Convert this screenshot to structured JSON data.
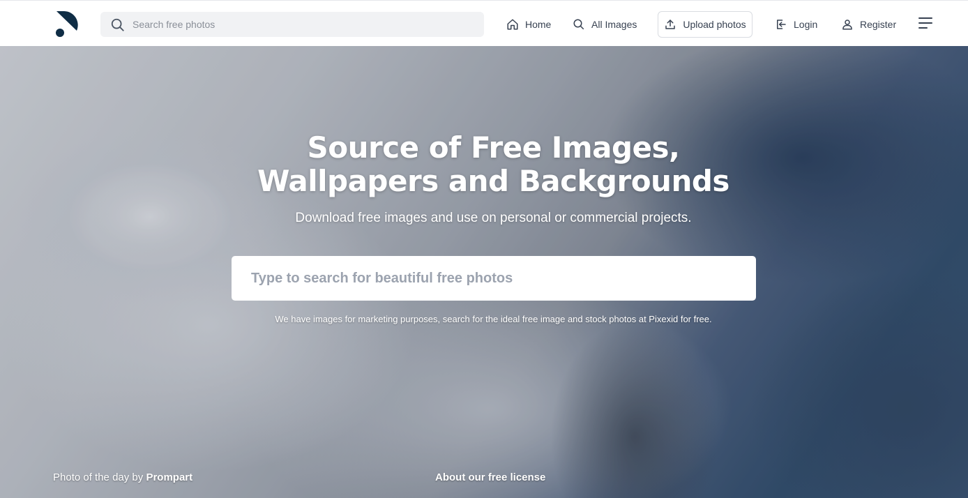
{
  "header": {
    "search": {
      "placeholder": "Search free photos"
    },
    "nav": {
      "home": "Home",
      "all_images": "All Images",
      "upload": "Upload photos",
      "login": "Login",
      "register": "Register"
    },
    "icons": [
      "logo",
      "search-icon",
      "home-icon",
      "search-icon",
      "upload-icon",
      "login-icon",
      "user-icon",
      "menu-icon"
    ]
  },
  "hero": {
    "title_line1": "Source of Free Images,",
    "title_line2": "Wallpapers and Backgrounds",
    "subtitle": "Download free images and use on personal or commercial projects.",
    "search_placeholder": "Type to search for beautiful free photos",
    "note": "We have images for marketing purposes, search for the ideal free image and stock photos at Pixexid for free.",
    "credit_prefix": "Photo of the day by",
    "credit_author": "Prompart",
    "license_link": "About our free license"
  },
  "colors": {
    "logo": "#0f2d45",
    "header_bg": "#ffffff",
    "search_bg": "#f1f2f4",
    "nav_text": "#374151"
  }
}
